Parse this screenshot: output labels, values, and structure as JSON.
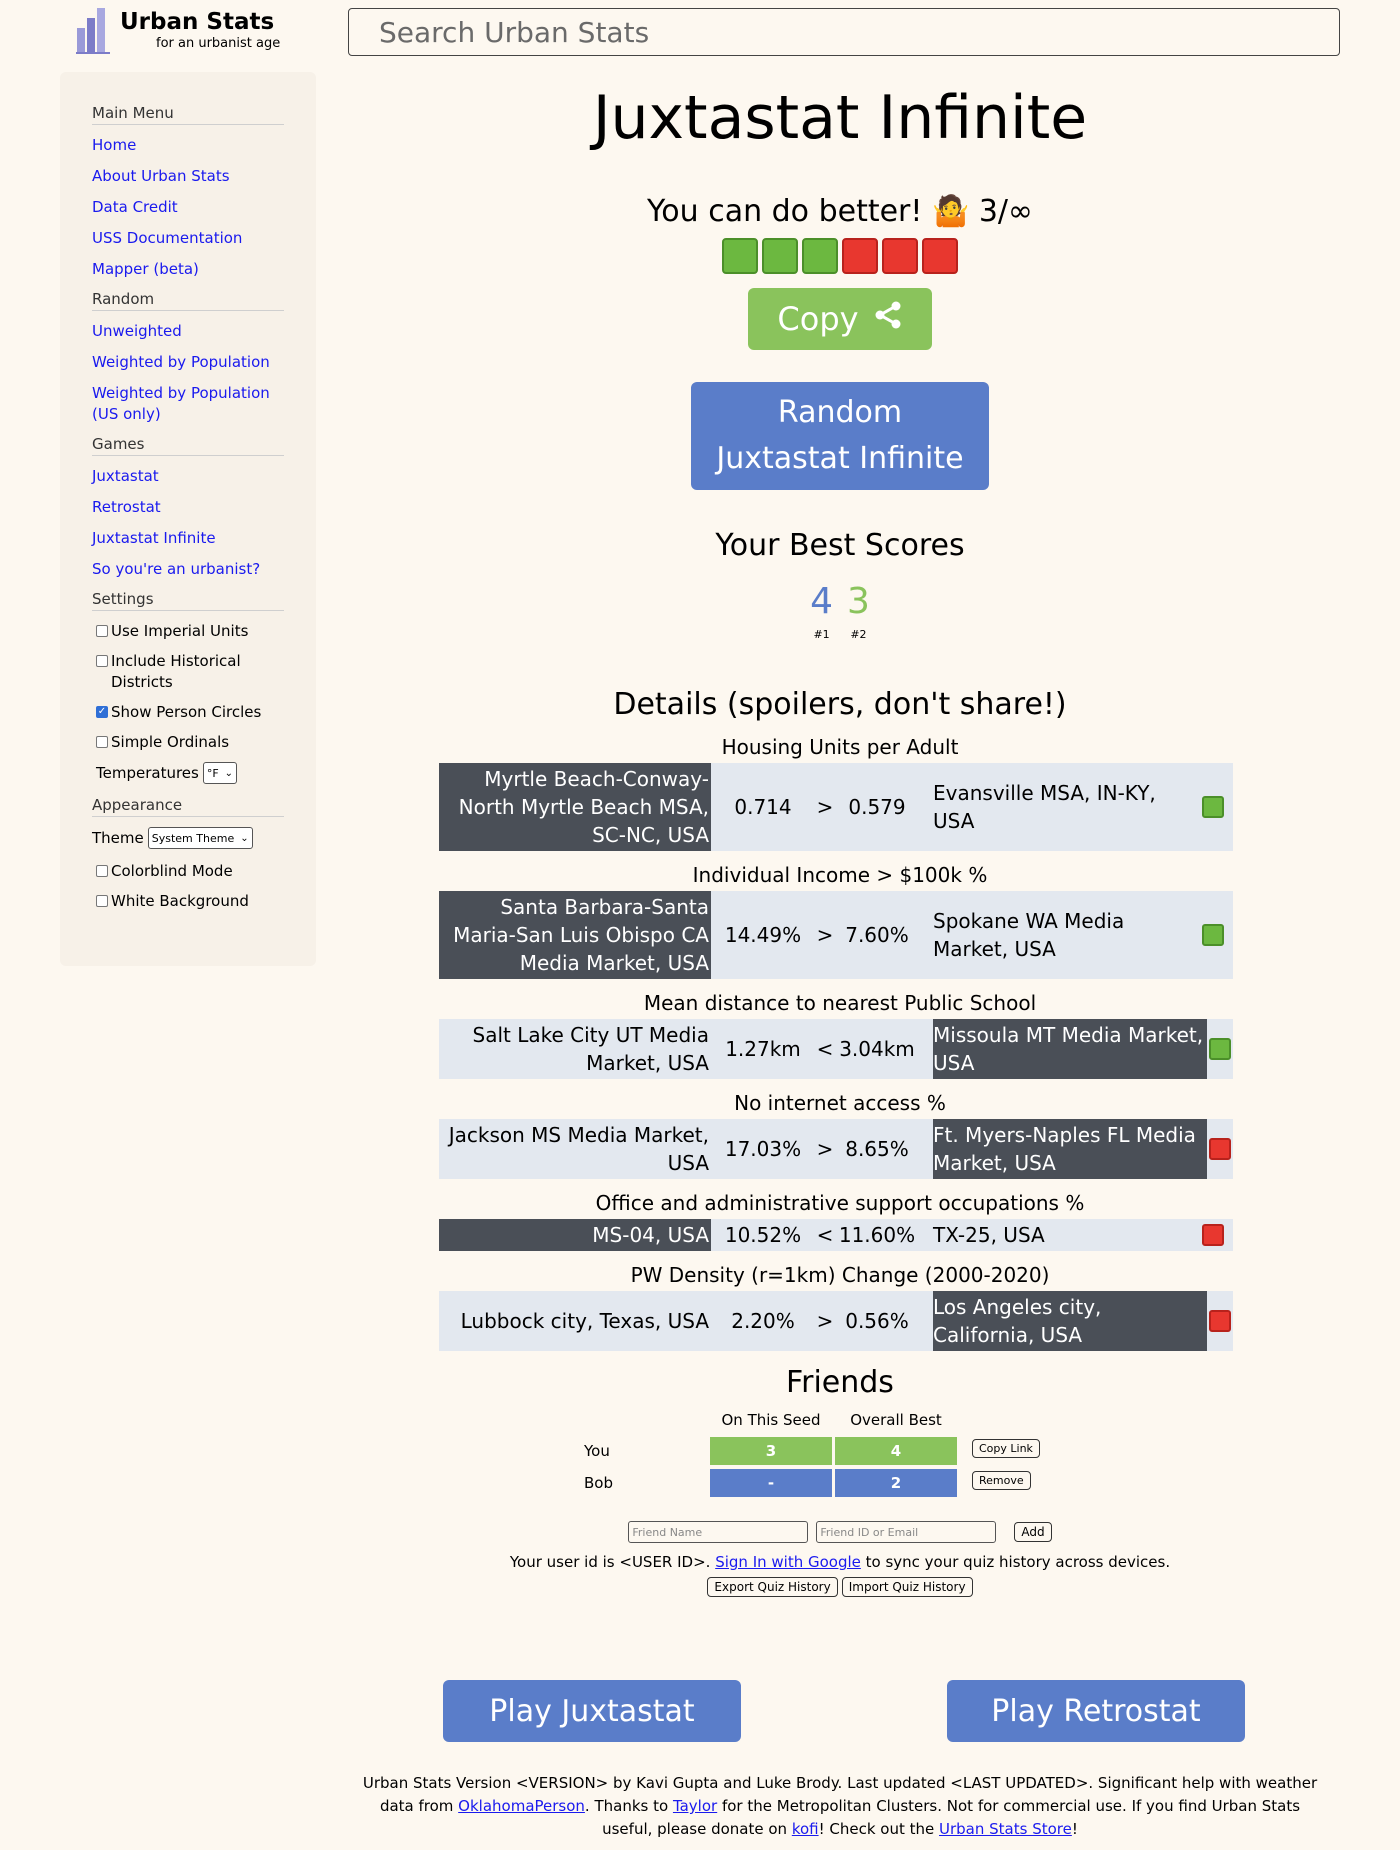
{
  "header": {
    "logo_title": "Urban Stats",
    "logo_subtitle": "for an urbanist age",
    "search_placeholder": "Search Urban Stats"
  },
  "sidebar": {
    "main_menu": {
      "heading": "Main Menu",
      "links": [
        "Home",
        "About Urban Stats",
        "Data Credit",
        "USS Documentation",
        "Mapper (beta)"
      ]
    },
    "random": {
      "heading": "Random",
      "links": [
        "Unweighted",
        "Weighted by Population",
        "Weighted by Population (US only)"
      ]
    },
    "games": {
      "heading": "Games",
      "links": [
        "Juxtastat",
        "Retrostat",
        "Juxtastat Infinite",
        "So you're an urbanist?"
      ]
    },
    "settings": {
      "heading": "Settings",
      "checks": [
        {
          "label": "Use Imperial Units",
          "checked": false
        },
        {
          "label": "Include Historical Districts",
          "checked": false
        },
        {
          "label": "Show Person Circles",
          "checked": true
        },
        {
          "label": "Simple Ordinals",
          "checked": false
        }
      ],
      "temperature_label": "Temperatures",
      "temperature_value": "°F"
    },
    "appearance": {
      "heading": "Appearance",
      "theme_label": "Theme",
      "theme_value": "System Theme",
      "checks": [
        {
          "label": "Colorblind Mode",
          "checked": false
        },
        {
          "label": "White Background",
          "checked": false
        }
      ]
    }
  },
  "main": {
    "title": "Juxtastat Infinite",
    "verdict": "You can do better! 🤷 3/∞",
    "result_squares": [
      "green",
      "green",
      "green",
      "red",
      "red",
      "red"
    ],
    "copy_label": "Copy",
    "random_button": "Random Juxtastat Infinite",
    "best_title": "Your Best Scores",
    "best_scores": [
      {
        "score": "4",
        "rank": "#1",
        "color": "#5a7dc9"
      },
      {
        "score": "3",
        "rank": "#2",
        "color": "#8ac35c"
      }
    ],
    "details_title": "Details (spoilers, don't share!)",
    "questions": [
      {
        "stat": "Housing Units per Adult",
        "left": "Myrtle Beach-Conway-North Myrtle Beach MSA, SC-NC, USA",
        "left_value": "0.714",
        "op": ">",
        "right_value": "0.579",
        "right": "Evansville MSA, IN-KY, USA",
        "chosen": "left",
        "correct": true
      },
      {
        "stat": "Individual Income > $100k %",
        "left": "Santa Barbara-Santa Maria-San Luis Obispo CA Media Market, USA",
        "left_value": "14.49%",
        "op": ">",
        "right_value": "7.60%",
        "right": "Spokane WA Media Market, USA",
        "chosen": "left",
        "correct": true
      },
      {
        "stat": "Mean distance to nearest Public School",
        "left": "Salt Lake City UT Media Market, USA",
        "left_value": "1.27km",
        "op": "<",
        "right_value": "3.04km",
        "right": "Missoula MT Media Market, USA",
        "chosen": "right",
        "correct": true
      },
      {
        "stat": "No internet access %",
        "left": "Jackson MS Media Market, USA",
        "left_value": "17.03%",
        "op": ">",
        "right_value": "8.65%",
        "right": "Ft. Myers-Naples FL Media Market, USA",
        "chosen": "right",
        "correct": false
      },
      {
        "stat": "Office and administrative support occupations %",
        "left": "MS-04, USA",
        "left_value": "10.52%",
        "op": "<",
        "right_value": "11.60%",
        "right": "TX-25, USA",
        "chosen": "left",
        "correct": false
      },
      {
        "stat": "PW Density (r=1km) Change (2000-2020)",
        "left": "Lubbock city, Texas, USA",
        "left_value": "2.20%",
        "op": ">",
        "right_value": "0.56%",
        "right": "Los Angeles city, California, USA",
        "chosen": "right",
        "correct": false
      }
    ],
    "friends": {
      "title": "Friends",
      "col_seed": "On This Seed",
      "col_best": "Overall Best",
      "rows": [
        {
          "name": "You",
          "seed": "3",
          "best": "4",
          "seed_color": "green",
          "best_color": "green",
          "action": "Copy Link"
        },
        {
          "name": "Bob",
          "seed": "-",
          "best": "2",
          "seed_color": "blue",
          "best_color": "blue",
          "action": "Remove"
        }
      ],
      "name_placeholder": "Friend Name",
      "id_placeholder": "Friend ID or Email",
      "add_label": "Add"
    },
    "userid_prefix": "Your user id is <USER ID>. ",
    "signin_link": "Sign In with Google",
    "userid_suffix": " to sync your quiz history across devices.",
    "export_label": "Export Quiz History",
    "import_label": "Import Quiz History",
    "play_juxtastat": "Play Juxtastat",
    "play_retrostat": "Play Retrostat"
  },
  "footer": {
    "t1": "Urban Stats Version <VERSION> by Kavi Gupta and Luke Brody. Last updated <LAST UPDATED>. Significant help with weather data from ",
    "link1": "OklahomaPerson",
    "t2": ". Thanks to ",
    "link2": "Taylor",
    "t3": " for the Metropolitan Clusters. Not for commercial use. If you find Urban Stats useful, please donate on ",
    "link3": "kofi",
    "t4": "! Check out the ",
    "link4": "Urban Stats Store",
    "t5": "!"
  }
}
